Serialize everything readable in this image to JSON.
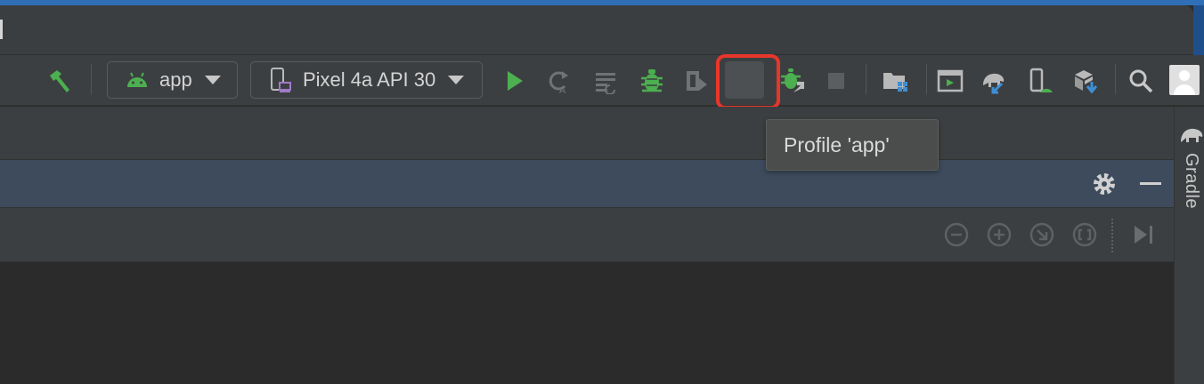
{
  "toolbar": {
    "run_config": {
      "label": "app",
      "icon": "android-icon"
    },
    "device": {
      "label": "Pixel 4a API 30",
      "icon": "device-icon"
    },
    "icons": [
      "hammer-icon",
      "run-icon",
      "apply-changes-restart-icon",
      "apply-code-changes-icon",
      "debug-icon",
      "coverage-icon",
      "profile-icon",
      "attach-debugger-icon",
      "stop-icon",
      "project-structure-icon",
      "layout-inspector-icon",
      "sync-gradle-icon",
      "avd-manager-icon",
      "sdk-manager-icon",
      "search-icon",
      "account-avatar"
    ],
    "highlighted": "profile-icon"
  },
  "tooltip": {
    "text": "Profile 'app'"
  },
  "panel": {
    "header_icons": [
      "gear-icon",
      "minimize-icon"
    ],
    "toolbar_icons": [
      "collapse-icon",
      "expand-icon",
      "filter-icon",
      "frame-icon",
      "skip-to-end-icon"
    ]
  },
  "side_tab": {
    "label": "Gradle",
    "icon": "elephant-icon"
  },
  "colors": {
    "accent_green": "#4caf50",
    "profile_blue": "#3d8fd6",
    "highlight_red": "#e8362a",
    "panel_header": "#3d4b5c"
  }
}
